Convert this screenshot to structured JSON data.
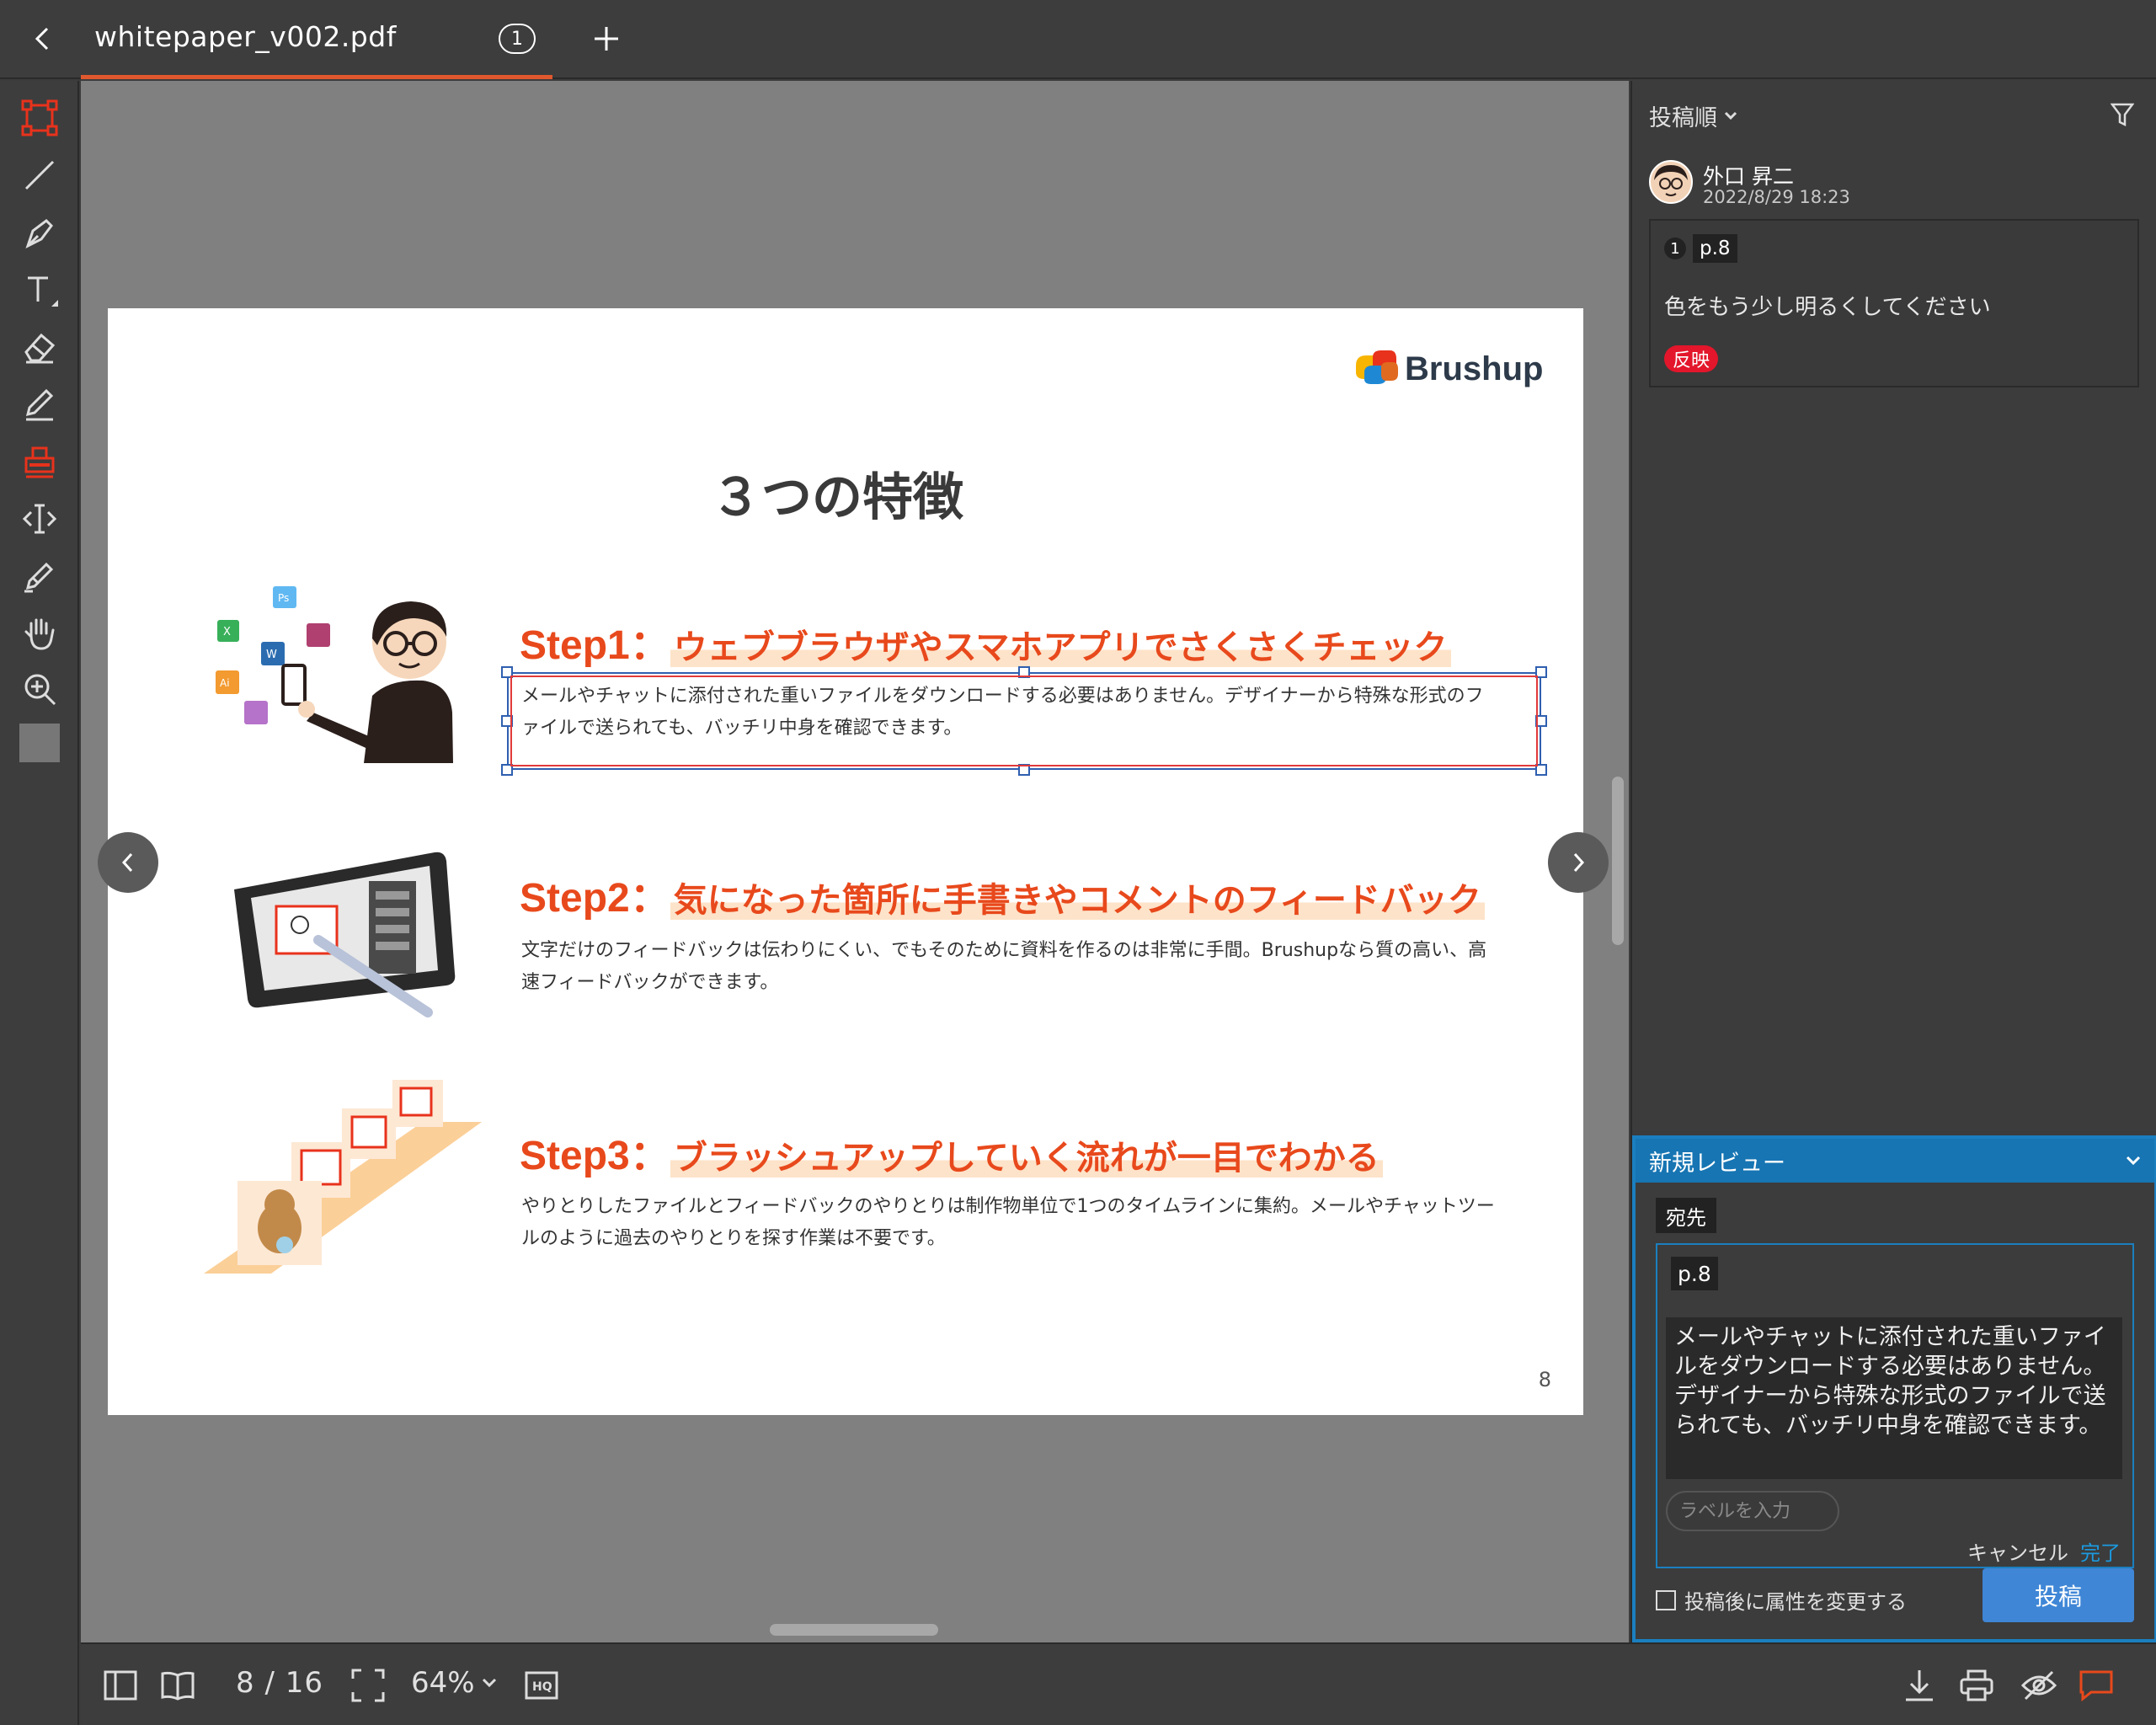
{
  "tab": {
    "title": "whitepaper_v002.pdf",
    "badge": "1"
  },
  "document": {
    "logo_text": "Brushup",
    "heading": "３つの特徴",
    "steps": [
      {
        "label": "Step1：",
        "title": "ウェブブラウザやスマホアプリでさくさくチェック",
        "body": "メールやチャットに添付された重いファイルをダウンロードする必要はありません。デザイナーから特殊な形式のファイルで送られても、バッチリ中身を確認できます。"
      },
      {
        "label": "Step2：",
        "title": "気になった箇所に手書きやコメントのフィードバック",
        "body": "文字だけのフィードバックは伝わりにくい、でもそのために資料を作るのは非常に手間。Brushupなら質の高い、高速フィードバックができます。"
      },
      {
        "label": "Step3：",
        "title": "ブラッシュアップしていく流れが一目でわかる",
        "body": "やりとりしたファイルとフィードバックのやりとりは制作物単位で1つのタイムラインに集約。メールやチャットツールのように過去のやりとりを探す作業は不要です。"
      }
    ],
    "page_number": "8"
  },
  "bottombar": {
    "page_indicator": "8 / 16",
    "zoom": "64%"
  },
  "panel": {
    "sort_label": "投稿順",
    "comment": {
      "author": "外口 昇二",
      "time": "2022/8/29 18:23",
      "number": "1",
      "page": "p.8",
      "text": "色をもう少し明るくしてください",
      "label": "反映"
    },
    "new_review": {
      "title": "新規レビュー",
      "to_label": "宛先",
      "page": "p.8",
      "text": "メールやチャットに添付された重いファイルをダウンロードする必要はありません。デザイナーから特殊な形式のファイルで送られても、バッチリ中身を確認できます。",
      "label_placeholder": "ラベルを入力",
      "cancel": "キャンセル",
      "done": "完了",
      "checkbox_label": "投稿後に属性を変更する",
      "post": "投稿"
    }
  },
  "colors": {
    "accent": "#e0582e",
    "selection": "#2f5fb0",
    "review_blue": "#1b7fbf",
    "label_red": "#e3162b",
    "step_orange": "#e8491c"
  }
}
